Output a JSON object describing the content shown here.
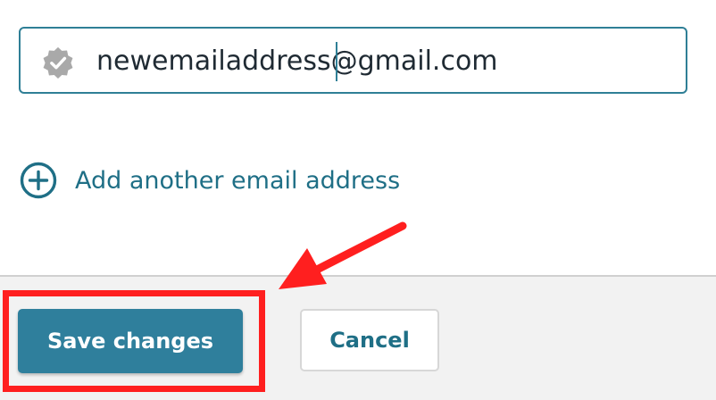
{
  "email_field": {
    "value": "newemailaddress@gmail.com",
    "status_icon": "verified-badge-icon"
  },
  "add_email": {
    "icon": "plus-circle-icon",
    "label": "Add another email address"
  },
  "footer": {
    "save_label": "Save changes",
    "cancel_label": "Cancel"
  },
  "annotations": {
    "highlight_color": "#ff1f1f",
    "arrow_icon": "arrow-icon"
  },
  "colors": {
    "accent": "#2f7f9c",
    "link": "#1f6f86",
    "footer_background": "#f2f2f2"
  }
}
